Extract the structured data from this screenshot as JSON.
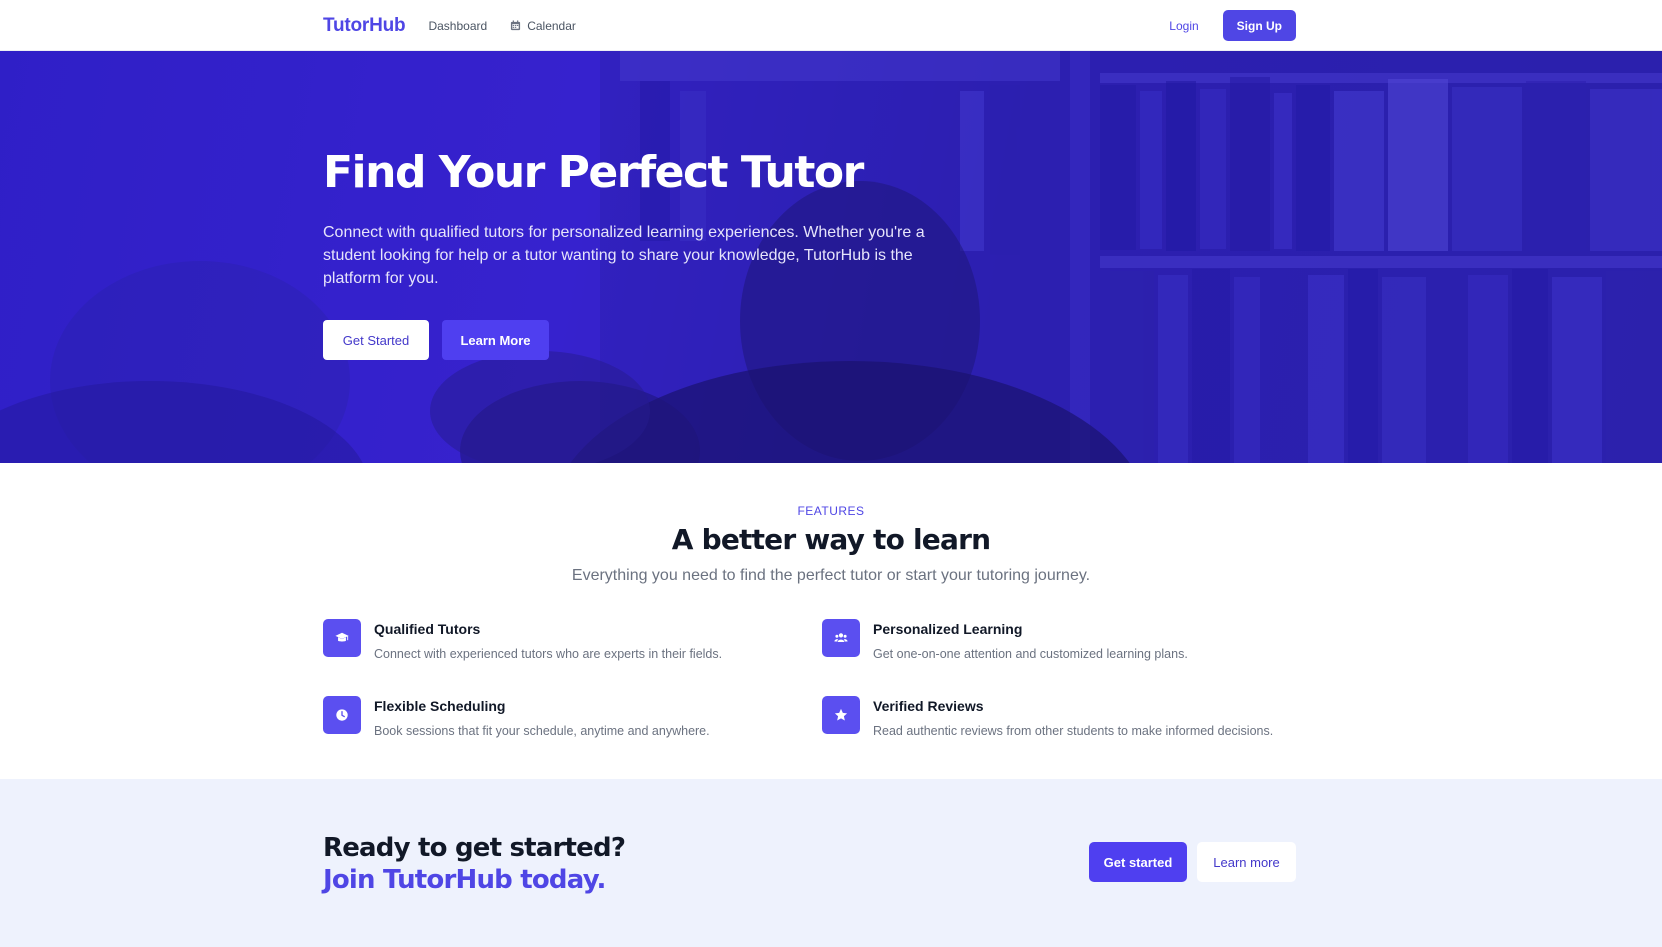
{
  "nav": {
    "brand": "TutorHub",
    "links": [
      {
        "label": "Dashboard",
        "icon": ""
      },
      {
        "label": "Calendar",
        "icon": "calendar-icon"
      }
    ],
    "login_label": "Login",
    "signup_label": "Sign Up"
  },
  "hero": {
    "title": "Find Your Perfect Tutor",
    "description": "Connect with qualified tutors for personalized learning experiences. Whether you're a student looking for help or a tutor wanting to share your knowledge, TutorHub is the platform for you.",
    "primary_button": "Get Started",
    "secondary_button": "Learn More"
  },
  "features": {
    "eyebrow": "FEATURES",
    "title": "A better way to learn",
    "subtitle": "Everything you need to find the perfect tutor or start your tutoring journey.",
    "items": [
      {
        "icon": "graduation-cap-icon",
        "title": "Qualified Tutors",
        "description": "Connect with experienced tutors who are experts in their fields."
      },
      {
        "icon": "users-icon",
        "title": "Personalized Learning",
        "description": "Get one-on-one attention and customized learning plans."
      },
      {
        "icon": "clock-icon",
        "title": "Flexible Scheduling",
        "description": "Book sessions that fit your schedule, anytime and anywhere."
      },
      {
        "icon": "star-icon",
        "title": "Verified Reviews",
        "description": "Read authentic reviews from other students to make informed decisions."
      }
    ]
  },
  "cta": {
    "line1": "Ready to get started?",
    "line2": "Join TutorHub today.",
    "primary_button": "Get started",
    "secondary_button": "Learn more"
  },
  "colors": {
    "brand": "#4f46e5",
    "hero_overlay": "#3423c9",
    "cta_background": "#eef2fd"
  }
}
